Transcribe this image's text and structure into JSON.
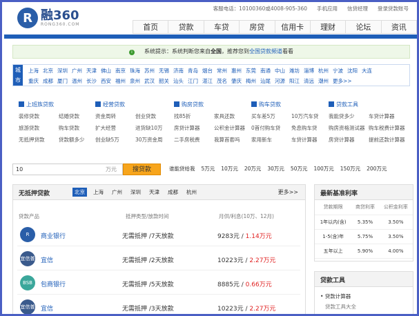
{
  "top": {
    "phone": "客服电话：10100360或4008-905-360",
    "mobile": "手机应用",
    "wechat": "信贷经理",
    "login": "登录贷款账号"
  },
  "logo": {
    "text": "融360",
    "sub": "RONG360.COM",
    "mark": "R"
  },
  "nav": [
    "首页",
    "贷款",
    "车贷",
    "房贷",
    "信用卡",
    "理财",
    "论坛",
    "资讯"
  ],
  "notice": {
    "pre": "系统提示：系统判断您来自",
    "loc": "全国",
    "mid": "，推荐您到",
    "link": "全国贷款频道",
    "post": "看看"
  },
  "cities": {
    "label": "城市",
    "row1": [
      "上海",
      "北京",
      "深圳",
      "广州",
      "天津",
      "佛山",
      "南京",
      "珠海",
      "苏州",
      "无锡",
      "济南",
      "青岛",
      "烟台",
      "常州",
      "惠州",
      "东莞",
      "南通",
      "中山",
      "潍坊",
      "淄博",
      "杭州",
      "宁波",
      "沈阳",
      "大连"
    ],
    "row2": [
      "重庆",
      "成都",
      "厦门",
      "温州",
      "长沙",
      "西安",
      "福州",
      "泉州",
      "武汉",
      "韶关",
      "汕头",
      "江门",
      "湛江",
      "茂名",
      "肇庆",
      "梅州",
      "汕尾",
      "河源",
      "阳江",
      "清远",
      "潮州",
      "更多>>"
    ]
  },
  "cats": [
    {
      "title": "上班族贷款",
      "items": [
        "装修贷款",
        "结婚贷款",
        "旅游贷款",
        "购车贷款",
        "无抵押贷款",
        "贷款额多少"
      ]
    },
    {
      "title": "经营贷款",
      "items": [
        "资金周转",
        "创业贷款",
        "扩大经营",
        "进货缺10万",
        "创业缺5万",
        "30万资金周"
      ]
    },
    {
      "title": "购房贷款",
      "items": [
        "找85折",
        "家具还款",
        "房贷计算器",
        "公积金计算器",
        "二手房税费",
        "我算首套吗"
      ]
    },
    {
      "title": "购车贷款",
      "items": [
        "买车差5万",
        "10万汽车贷",
        "0首付购车贷",
        "免息购车贷",
        "家用新车",
        "车贷计算器"
      ]
    },
    {
      "title": "贷款工具",
      "items": [
        "我能贷多少",
        "车贷计算器",
        "购房资格测试器",
        "购车税费计算器",
        "房贷计算器",
        "提前还款计算器"
      ]
    }
  ],
  "search": {
    "value": "10",
    "unit": "万元",
    "button": "搜贷款",
    "label": "谁能贷给我",
    "amounts": [
      "5万元",
      "10万元",
      "20万元",
      "30万元",
      "50万元",
      "100万元",
      "150万元",
      "200万元"
    ]
  },
  "list": {
    "title": "无抵押贷款",
    "tabs": [
      "北京",
      "上海",
      "广州",
      "深圳",
      "天津",
      "成都",
      "杭州"
    ],
    "more": "更多>>",
    "cols": [
      "贷款产品",
      "抵押类型/放款时间",
      "月供/利息(10万、12月)"
    ],
    "rows": [
      {
        "bank": "商业银行",
        "badge": "R",
        "color": "#2a5ea8",
        "type": "无需抵押 /7天放款",
        "pay": "9283元 / ",
        "int": "1.14万元"
      },
      {
        "bank": "宜信",
        "badge": "宜信普惠",
        "color": "#3a5a8c",
        "type": "无需抵押 /2天放款",
        "pay": "10223元 / ",
        "int": "2.27万元"
      },
      {
        "bank": "包商银行",
        "badge": "BSB",
        "color": "#3ba79b",
        "type": "无需抵押 /5天放款",
        "pay": "8885元 / ",
        "int": "0.66万元"
      },
      {
        "bank": "宜信",
        "badge": "宜信普惠",
        "color": "#3a5a8c",
        "type": "无需抵押 /3天放款",
        "pay": "10223元 / ",
        "int": "2.27万元"
      }
    ]
  },
  "rates": {
    "title": "最新基准利率",
    "head": [
      "贷款期限",
      "商贷利率",
      "公积金利率"
    ],
    "rows": [
      [
        "1年以内(含)",
        "5.35%",
        "3.50%"
      ],
      [
        "1-5(含)年",
        "5.75%",
        "3.50%"
      ],
      [
        "五年以上",
        "5.90%",
        "4.00%"
      ]
    ]
  },
  "tools": {
    "title": "贷款工具",
    "items": [
      "贷款计算器",
      "贷款工具大全"
    ]
  }
}
